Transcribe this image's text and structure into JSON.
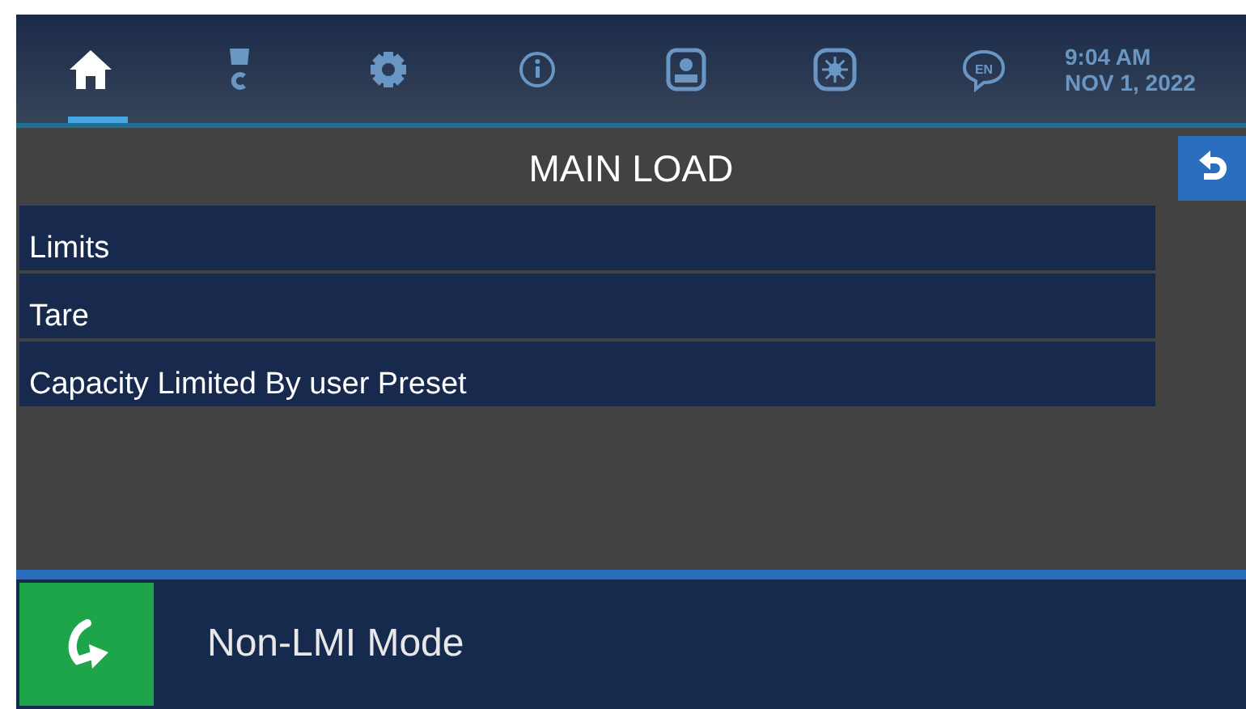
{
  "nav_tabs": [
    {
      "kind": "home",
      "selected": true
    },
    {
      "kind": "hook",
      "selected": false
    },
    {
      "kind": "gear",
      "selected": false
    },
    {
      "kind": "info",
      "selected": false
    },
    {
      "kind": "operator",
      "selected": false
    },
    {
      "kind": "brightness",
      "selected": false
    },
    {
      "kind": "language",
      "label": "EN",
      "selected": false
    }
  ],
  "clock": {
    "time": "9:04 AM",
    "date": "NOV 1, 2022"
  },
  "page": {
    "title": "MAIN LOAD"
  },
  "menu_items": [
    {
      "label": "Limits"
    },
    {
      "label": "Tare"
    },
    {
      "label": "Capacity Limited By user Preset"
    }
  ],
  "footer": {
    "mode": "Non-LMI Mode"
  }
}
